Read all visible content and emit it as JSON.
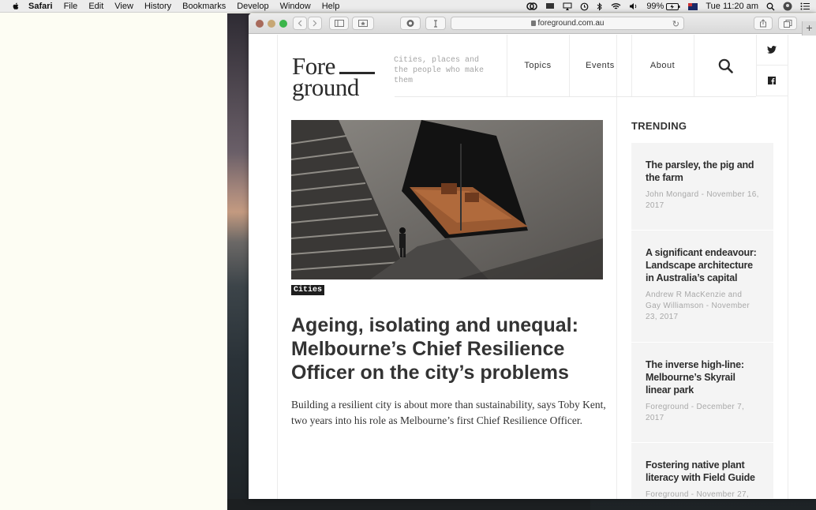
{
  "menubar": {
    "app": "Safari",
    "items": [
      "File",
      "Edit",
      "View",
      "History",
      "Bookmarks",
      "Develop",
      "Window",
      "Help"
    ],
    "battery": "99%",
    "clock": "Tue 11:20 am"
  },
  "browser": {
    "url": "foreground.com.au"
  },
  "site": {
    "logo_line1": "Fore",
    "logo_line2": "ground",
    "tagline": "Cities, places and the people who make them",
    "nav": [
      "Topics",
      "Events",
      "About"
    ]
  },
  "article": {
    "category": "Cities",
    "headline": "Ageing, isolating and unequal: Melbourne’s Chief Resilience Officer on the city’s problems",
    "dek": "Building a resilient city is about more than sustainability, says Toby Kent, two years into his role as Melbourne’s first Chief Resilience Officer."
  },
  "trending": {
    "title": "TRENDING",
    "items": [
      {
        "title": "The parsley, the pig and the farm",
        "meta": "John Mongard - November 16, 2017"
      },
      {
        "title": "A significant endeavour: Landscape architecture in Australia’s capital",
        "meta": "Andrew R MacKenzie and Gay Williamson - November 23, 2017"
      },
      {
        "title": "The inverse high-line: Melbourne’s Skyrail linear park",
        "meta": "Foreground - December 7, 2017"
      },
      {
        "title": "Fostering native plant literacy with Field Guide",
        "meta": "Foreground - November 27,"
      }
    ]
  }
}
